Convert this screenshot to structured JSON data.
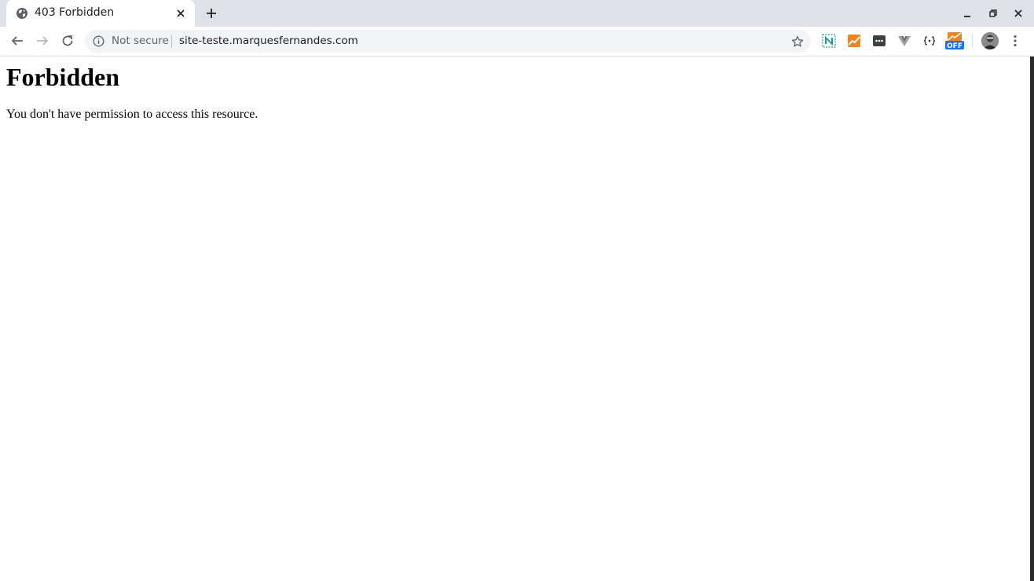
{
  "browser": {
    "tab": {
      "title": "403 Forbidden",
      "favicon": "globe-icon"
    },
    "toolbar": {
      "security_label": "Not secure",
      "url": "site-teste.marquesfernandes.com",
      "extensions": [
        "wappalyzer-n-icon",
        "orange-chart-icon",
        "dark-dots-icon",
        "vue-icon",
        "json-braces-icon",
        "off-badge-icon"
      ],
      "extension_badge": "OFF"
    },
    "colors": {
      "tabstrip": "#dee1e6",
      "omnibox": "#f1f3f4",
      "accent": "#1a73e8"
    }
  },
  "page": {
    "heading": "Forbidden",
    "message": "You don't have permission to access this resource."
  }
}
